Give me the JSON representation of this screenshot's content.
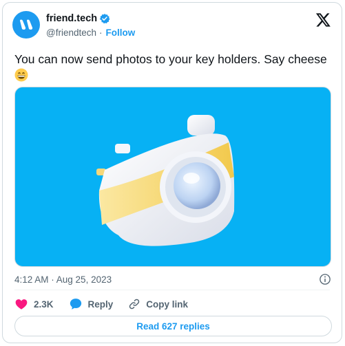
{
  "tweet": {
    "author": {
      "name": "friend.tech",
      "handle": "@friendtech",
      "separator": "·",
      "follow_label": "Follow",
      "verified": true
    },
    "text": "You can now send photos to your key holders. Say cheese",
    "emoji": "grinning-face-emoji",
    "media": {
      "background": "#07b1f4",
      "subject": "camera-illustration"
    },
    "timestamp": "4:12 AM · Aug 25, 2023",
    "actions": {
      "like_count": "2.3K",
      "reply_label": "Reply",
      "copy_label": "Copy link"
    },
    "read_replies_label": "Read 627 replies"
  },
  "colors": {
    "accent": "#1d9bf0",
    "like": "#f91880",
    "text": "#0f1419",
    "muted": "#536471",
    "border": "#cfd9de"
  },
  "icons": [
    "verified-badge-icon",
    "x-logo-icon",
    "info-icon",
    "heart-icon",
    "reply-bubble-icon",
    "link-icon"
  ]
}
